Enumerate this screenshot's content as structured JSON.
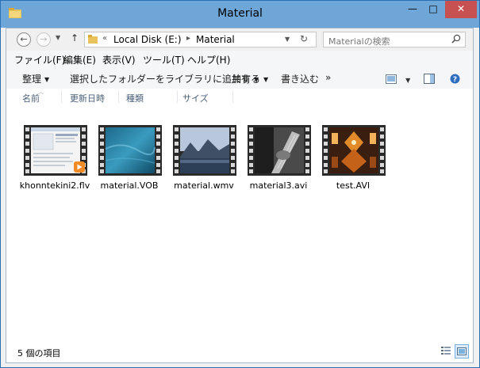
{
  "window": {
    "title": "Material",
    "minimize": "—",
    "maximize": "□",
    "close": "✕"
  },
  "address": {
    "back_icon": "arrow-left-icon",
    "forward_icon": "arrow-right-icon",
    "overflow": "«",
    "separator": "▸",
    "crumbs": [
      "Local Disk (E:)",
      "Material"
    ],
    "search_placeholder": "Materialの検索"
  },
  "menu": [
    "ファイル(F)",
    "編集(E)",
    "表示(V)",
    "ツール(T)",
    "ヘルプ(H)"
  ],
  "commands": {
    "organize": "整理",
    "add_library": "選択したフォルダーをライブラリに追加する",
    "share": "共有",
    "burn": "書き込む",
    "more": "»"
  },
  "columns": [
    "名前",
    "更新日時",
    "種類",
    "サイズ"
  ],
  "files": [
    {
      "name": "khonntekini2.flv",
      "thumb": "document-screenshot"
    },
    {
      "name": "material.VOB",
      "thumb": "blue-water"
    },
    {
      "name": "material.wmv",
      "thumb": "mountain-lake"
    },
    {
      "name": "material3.avi",
      "thumb": "guitar"
    },
    {
      "name": "test.AVI",
      "thumb": "orange-pattern"
    }
  ],
  "status": {
    "count": "5 個の項目"
  },
  "colors": {
    "titlebar": "#6fa6d8",
    "close": "#c75050",
    "accent": "#2b6fb3"
  }
}
